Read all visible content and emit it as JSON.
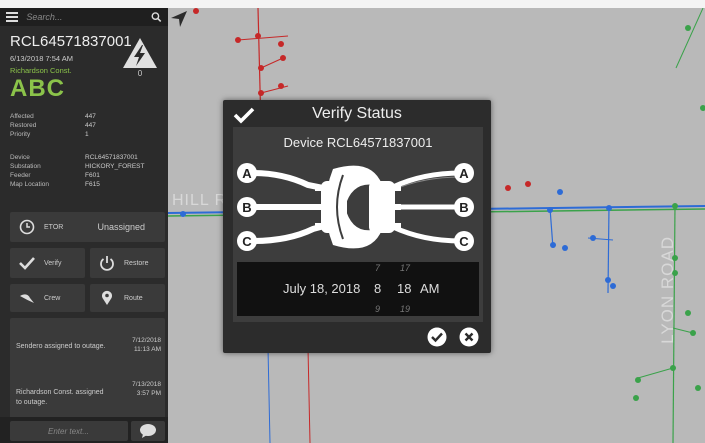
{
  "search": {
    "placeholder": "Search..."
  },
  "ticket": {
    "id": "RCL64571837001",
    "datetime": "6/13/2018 7:54 AM",
    "crew": "Richardson Const.",
    "code": "ABC",
    "bolt_count": "0"
  },
  "stats": [
    {
      "label": "Affected",
      "value": "447"
    },
    {
      "label": "Restored",
      "value": "447"
    },
    {
      "label": "Priority",
      "value": "1"
    }
  ],
  "details": [
    {
      "label": "Device",
      "value": "RCL64571837001"
    },
    {
      "label": "Substation",
      "value": "HICKORY_FOREST"
    },
    {
      "label": "Feeder",
      "value": "F601"
    },
    {
      "label": "Map Location",
      "value": "F615"
    }
  ],
  "actions": {
    "etor_label": "ETOR",
    "etor_status": "Unassigned",
    "verify_label": "Verify",
    "restore_label": "Restore",
    "crew_label": "Crew",
    "route_label": "Route"
  },
  "log": [
    {
      "message": "Sendero assigned to outage.",
      "date": "7/12/2018",
      "time": "11:13 AM"
    },
    {
      "message": "Richardson Const. assigned to outage.",
      "date": "7/13/2018",
      "time": "3:57 PM"
    }
  ],
  "chat": {
    "placeholder": "Enter text..."
  },
  "map": {
    "road_hill": "HILL R",
    "road_lyon": "LYON ROAD"
  },
  "modal": {
    "title": "Verify Status",
    "device": "Device RCL64571837001",
    "phases": [
      "A",
      "B",
      "C"
    ],
    "picker": {
      "date": "July 18, 2018",
      "hour": "8",
      "minute": "18",
      "ampm": "AM",
      "hour_prev": "7",
      "minute_prev": "17",
      "hour_next": "9",
      "minute_next": "19"
    }
  },
  "colors": {
    "accent_green": "#8bc34a",
    "sidebar_bg": "#2b2b2b",
    "modal_bg": "#2c2c2c"
  }
}
